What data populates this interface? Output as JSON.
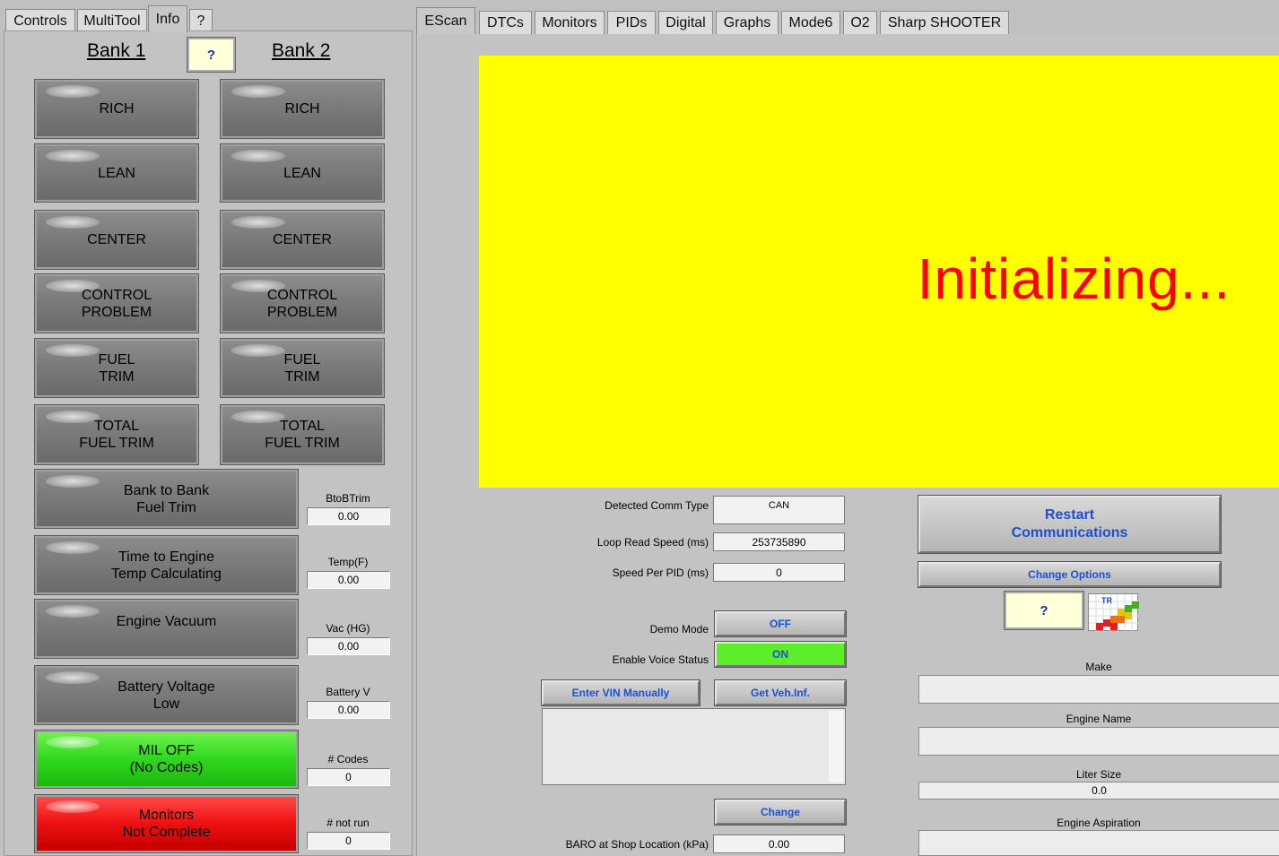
{
  "left_tabs": [
    "Controls",
    "MultiTool",
    "Info",
    "?"
  ],
  "right_tabs": [
    "EScan",
    "DTCs",
    "Monitors",
    "PIDs",
    "Digital",
    "Graphs",
    "Mode6",
    "O2",
    "Sharp SHOOTER"
  ],
  "banks": {
    "bank1_title": "Bank 1",
    "bank2_title": "Bank 2",
    "help": "?"
  },
  "bank_buttons": {
    "bank1": [
      "RICH",
      "LEAN",
      "CENTER",
      "CONTROL\nPROBLEM",
      "FUEL\nTRIM",
      "TOTAL\nFUEL TRIM"
    ],
    "bank2": [
      "RICH",
      "LEAN",
      "CENTER",
      "CONTROL\nPROBLEM",
      "FUEL\nTRIM",
      "TOTAL\nFUEL TRIM"
    ]
  },
  "indicators": [
    {
      "label": "Bank to Bank\nFuel Trim",
      "value_label": "BtoBTrim",
      "value": "0.00"
    },
    {
      "label": "Time to Engine\nTemp Calculating",
      "value_label": "Temp(F)",
      "value": "0.00"
    },
    {
      "label": "Engine Vacuum",
      "value_label": "Vac (HG)",
      "value": "0.00"
    },
    {
      "label": "Battery Voltage\nLow",
      "value_label": "Battery V",
      "value": "0.00"
    },
    {
      "label": "MIL OFF\n(No Codes)",
      "value_label": "# Codes",
      "value": "0"
    },
    {
      "label": "Monitors\nNot Complete",
      "value_label": "# not run",
      "value": "0"
    }
  ],
  "status": {
    "text": "Initializing...",
    "background": "#ffff00",
    "color": "#ff0000"
  },
  "comm": {
    "detected_comm_type_label": "Detected Comm Type",
    "detected_comm_type": "CAN",
    "loop_read_speed_label": "Loop Read Speed (ms)",
    "loop_read_speed": "253735890",
    "speed_per_pid_label": "Speed Per PID (ms)",
    "speed_per_pid": "0",
    "demo_mode_label": "Demo Mode",
    "demo_mode": "OFF",
    "voice_status_label": "Enable Voice Status",
    "voice_status": "ON"
  },
  "buttons": {
    "restart": "Restart\nCommunications",
    "change_options": "Change Options",
    "help": "?",
    "enter_vin": "Enter VIN Manually",
    "get_veh_inf": "Get Veh.Inf.",
    "change": "Change"
  },
  "baro": {
    "label": "BARO at Shop Location (kPa)",
    "value": "0.00"
  },
  "vehicle": {
    "make_label": "Make",
    "make": "",
    "engine_name_label": "Engine Name",
    "engine_name": "",
    "liter_size_label": "Liter Size",
    "liter_size": "0.0",
    "engine_aspiration_label": "Engine Aspiration",
    "engine_aspiration": ""
  },
  "colors": {
    "accent": "#1d4fd1",
    "on": "#5dee2b",
    "mil_off": "#2fd81c",
    "monitors_warn": "#ee1010"
  }
}
